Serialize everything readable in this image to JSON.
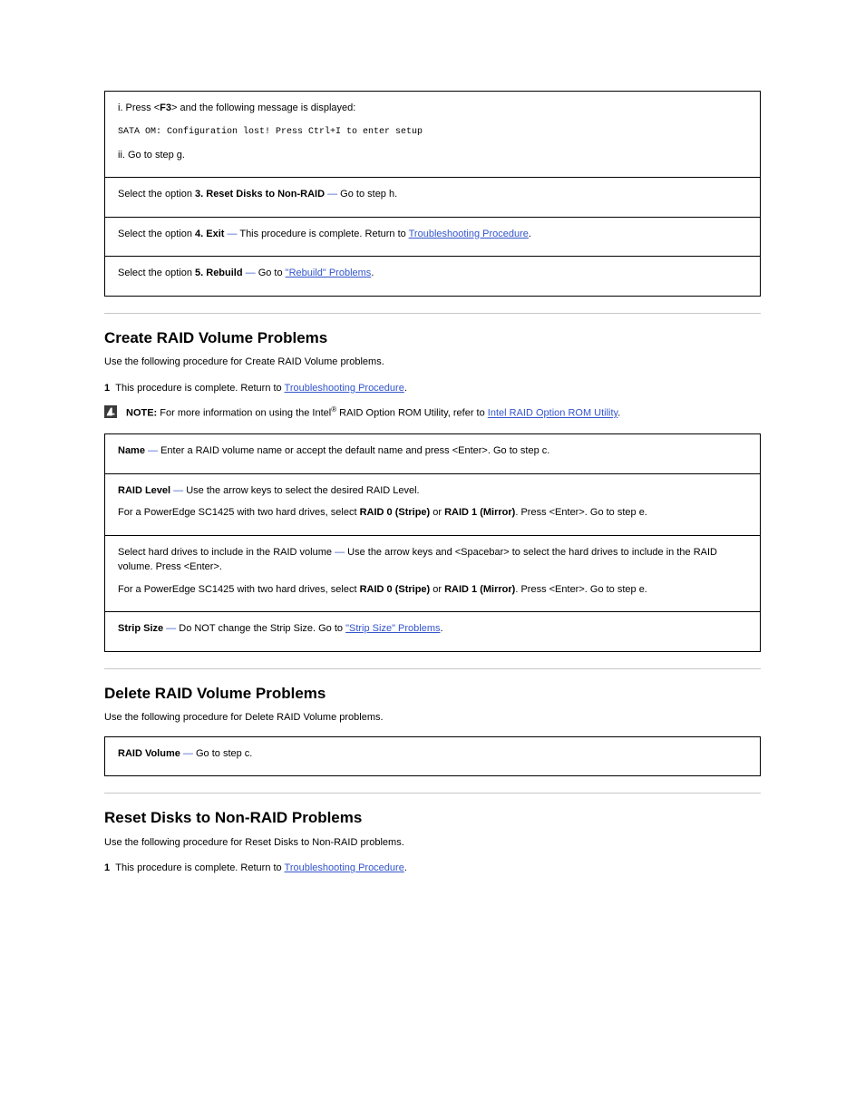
{
  "table1": {
    "rows": [
      {
        "pre": "i. Press <",
        "key_bold": "F3",
        "post_key": "> and the following message is displayed:",
        "message": "SATA OM: Configuration lost! Press Ctrl+I to enter setup",
        "after": "ii. Go to step g."
      },
      {
        "label_pre": "Select the option ",
        "label_bold": "3. Reset Disks to Non-RAID",
        "label_dash": " — ",
        "label_post": "Go to step h."
      },
      {
        "label_pre": "Select the option ",
        "label_bold": "4. Exit",
        "label_dash": " — ",
        "label_post": "This procedure is complete. Return to ",
        "link": "Troubleshooting Procedure",
        "label_end": "."
      },
      {
        "label_pre": "Select the option ",
        "label_bold": "5. Rebuild",
        "label_dash": " — ",
        "label_post": "Go to ",
        "link": "\"Rebuild\" Problems",
        "label_end": "."
      }
    ]
  },
  "section1": {
    "title": "Create RAID Volume Problems",
    "lead": "Use the following procedure for Create RAID Volume problems.",
    "step": {
      "num": "1",
      "pre": "This procedure is complete. Return to ",
      "link": "Troubleshooting Procedure",
      "post": "."
    },
    "note": {
      "label": "NOTE:",
      "pre": " For more information on using the Intel",
      "reg": "®",
      "mid": " RAID Option ROM Utility, refer to ",
      "link": "Intel RAID Option ROM Utility",
      "post": "."
    }
  },
  "table2": {
    "rows": [
      {
        "bold": "Name",
        "dash": " — ",
        "rest": "Enter a RAID volume name or accept the default name and press <Enter>. Go to step c."
      },
      {
        "bold": "RAID Level",
        "dash": " — ",
        "rest1": "Use the arrow keys to select the desired RAID Level.",
        "rest2_pre": "For a PowerEdge SC1425 with two hard drives, select ",
        "rest2_bold": "RAID 0 (Stripe)",
        "rest2_mid": " or ",
        "rest2_bold2": "RAID 1 (Mirror)",
        "rest2_post": ". Press <Enter>. Go to step e."
      },
      {
        "pre": "Select hard drives to include in the RAID volume",
        "dash": " — ",
        "rest1": "Use the arrow keys and <Spacebar> to select the hard drives to include in the RAID volume. Press <Enter>.",
        "rest2_pre": "For a PowerEdge SC1425 with two hard drives, select ",
        "rest2_bold": "RAID 0 (Stripe)",
        "rest2_mid": " or ",
        "rest2_bold2": "RAID 1 (Mirror)",
        "rest2_post": ". Press <Enter>. Go to step e."
      },
      {
        "bold": "Strip Size",
        "dash": " — ",
        "rest": "Do NOT change the Strip Size. Go to ",
        "link": "\"Strip Size\" Problems",
        "post": "."
      }
    ]
  },
  "section2": {
    "title": "Delete RAID Volume Problems",
    "lead": "Use the following procedure for Delete RAID Volume problems."
  },
  "table3": {
    "row": {
      "bold": "RAID Volume",
      "dash": " — ",
      "rest": "Go to step c."
    }
  },
  "section3": {
    "title": "Reset Disks to Non-RAID Problems",
    "lead": "Use the following procedure for Reset Disks to Non-RAID problems.",
    "step": {
      "num": "1",
      "pre": "This procedure is complete. Return to ",
      "link": "Troubleshooting Procedure",
      "post": "."
    }
  }
}
